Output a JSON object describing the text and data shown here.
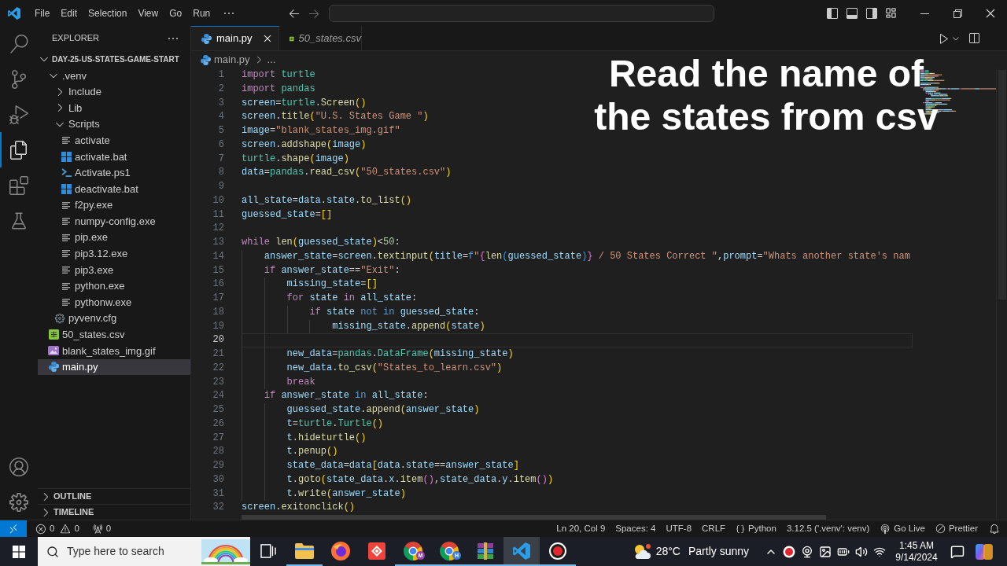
{
  "title_bar": {
    "menu": [
      "File",
      "Edit",
      "Selection",
      "View",
      "Go",
      "Run"
    ]
  },
  "activity_bar": {
    "items": [
      {
        "kind": "search",
        "selected": false
      },
      {
        "kind": "source_control",
        "selected": false
      },
      {
        "kind": "run_debug",
        "selected": false
      },
      {
        "kind": "explorer",
        "selected": true
      },
      {
        "kind": "extensions",
        "selected": false
      },
      {
        "kind": "testing",
        "selected": false
      }
    ]
  },
  "sidebar": {
    "title": "EXPLORER",
    "folder": {
      "name": "DAY-25-US-STATES-GAME-START",
      "expanded": true,
      "children": [
        {
          "name": ".venv",
          "kind": "folder",
          "expanded": true,
          "selected": false,
          "children": [
            {
              "name": "Include",
              "kind": "folder",
              "expanded": false,
              "selected": false
            },
            {
              "name": "Lib",
              "kind": "folder",
              "expanded": false,
              "selected": false
            },
            {
              "name": "Scripts",
              "kind": "folder",
              "expanded": true,
              "selected": false,
              "children": [
                {
                  "name": "activate",
                  "kind": "text",
                  "selected": false
                },
                {
                  "name": "activate.bat",
                  "kind": "batch",
                  "selected": false
                },
                {
                  "name": "Activate.ps1",
                  "kind": "powershell",
                  "selected": false
                },
                {
                  "name": "deactivate.bat",
                  "kind": "batch",
                  "selected": false
                },
                {
                  "name": "f2py.exe",
                  "kind": "text",
                  "selected": false
                },
                {
                  "name": "numpy-config.exe",
                  "kind": "text",
                  "selected": false
                },
                {
                  "name": "pip.exe",
                  "kind": "text",
                  "selected": false
                },
                {
                  "name": "pip3.12.exe",
                  "kind": "text",
                  "selected": false
                },
                {
                  "name": "pip3.exe",
                  "kind": "text",
                  "selected": false
                },
                {
                  "name": "python.exe",
                  "kind": "text",
                  "selected": false
                },
                {
                  "name": "pythonw.exe",
                  "kind": "text",
                  "selected": false
                }
              ]
            },
            {
              "name": "pyvenv.cfg",
              "kind": "config",
              "selected": false
            }
          ]
        },
        {
          "name": "50_states.csv",
          "kind": "csv",
          "selected": false
        },
        {
          "name": "blank_states_img.gif",
          "kind": "image",
          "selected": false
        },
        {
          "name": "main.py",
          "kind": "python",
          "selected": true
        }
      ]
    },
    "sections": [
      {
        "name": "OUTLINE",
        "expanded": false
      },
      {
        "name": "TIMELINE",
        "expanded": false
      }
    ]
  },
  "tabs": [
    {
      "label": "main.py",
      "kind": "python",
      "selected": true,
      "preview": false
    },
    {
      "label": "50_states.csv",
      "kind": "csv",
      "selected": false,
      "preview": true
    }
  ],
  "breadcrumb": {
    "file": "main.py",
    "kind": "python",
    "more": "..."
  },
  "editor": {
    "caption": [
      "Read the name of",
      "the states from csv"
    ],
    "lines": [
      {
        "number": "1",
        "current": false,
        "tokens": [
          {
            "kind": "keyword",
            "text": "import "
          },
          {
            "kind": "type",
            "text": "turtle"
          }
        ]
      },
      {
        "number": "2",
        "current": false,
        "tokens": [
          {
            "kind": "keyword",
            "text": "import "
          },
          {
            "kind": "type",
            "text": "pandas"
          }
        ]
      },
      {
        "number": "3",
        "current": false,
        "tokens": [
          {
            "kind": "variable",
            "text": "screen"
          },
          {
            "kind": "plain",
            "text": "="
          },
          {
            "kind": "type",
            "text": "turtle"
          },
          {
            "kind": "plain",
            "text": "."
          },
          {
            "kind": "function",
            "text": "Screen"
          },
          {
            "kind": "bracket",
            "text": "()"
          }
        ]
      },
      {
        "number": "4",
        "current": false,
        "tokens": [
          {
            "kind": "variable",
            "text": "screen"
          },
          {
            "kind": "plain",
            "text": "."
          },
          {
            "kind": "function",
            "text": "title"
          },
          {
            "kind": "bracket",
            "text": "("
          },
          {
            "kind": "string",
            "text": "\"U.S. States Game \""
          },
          {
            "kind": "bracket",
            "text": ")"
          }
        ]
      },
      {
        "number": "5",
        "current": false,
        "tokens": [
          {
            "kind": "variable",
            "text": "image"
          },
          {
            "kind": "plain",
            "text": "="
          },
          {
            "kind": "string",
            "text": "\"blank_states_img.gif\""
          }
        ]
      },
      {
        "number": "6",
        "current": false,
        "tokens": [
          {
            "kind": "variable",
            "text": "screen"
          },
          {
            "kind": "plain",
            "text": "."
          },
          {
            "kind": "function",
            "text": "addshape"
          },
          {
            "kind": "bracket",
            "text": "("
          },
          {
            "kind": "variable",
            "text": "image"
          },
          {
            "kind": "bracket",
            "text": ")"
          }
        ]
      },
      {
        "number": "7",
        "current": false,
        "tokens": [
          {
            "kind": "type",
            "text": "turtle"
          },
          {
            "kind": "plain",
            "text": "."
          },
          {
            "kind": "function",
            "text": "shape"
          },
          {
            "kind": "bracket",
            "text": "("
          },
          {
            "kind": "variable",
            "text": "image"
          },
          {
            "kind": "bracket",
            "text": ")"
          }
        ]
      },
      {
        "number": "8",
        "current": false,
        "tokens": [
          {
            "kind": "variable",
            "text": "data"
          },
          {
            "kind": "plain",
            "text": "="
          },
          {
            "kind": "type",
            "text": "pandas"
          },
          {
            "kind": "plain",
            "text": "."
          },
          {
            "kind": "function",
            "text": "read_csv"
          },
          {
            "kind": "bracket",
            "text": "("
          },
          {
            "kind": "string",
            "text": "\"50_states.csv\""
          },
          {
            "kind": "bracket",
            "text": ")"
          }
        ]
      },
      {
        "number": "9",
        "current": false
      },
      {
        "number": "10",
        "current": false,
        "tokens": [
          {
            "kind": "variable",
            "text": "all_state"
          },
          {
            "kind": "plain",
            "text": "="
          },
          {
            "kind": "variable",
            "text": "data"
          },
          {
            "kind": "plain",
            "text": "."
          },
          {
            "kind": "variable",
            "text": "state"
          },
          {
            "kind": "plain",
            "text": "."
          },
          {
            "kind": "function",
            "text": "to_list"
          },
          {
            "kind": "bracket",
            "text": "()"
          }
        ]
      },
      {
        "number": "11",
        "current": false,
        "tokens": [
          {
            "kind": "variable",
            "text": "guessed_state"
          },
          {
            "kind": "plain",
            "text": "="
          },
          {
            "kind": "bracket",
            "text": "[]"
          }
        ]
      },
      {
        "number": "12",
        "current": false
      },
      {
        "number": "13",
        "current": false,
        "tokens": [
          {
            "kind": "keyword",
            "text": "while "
          },
          {
            "kind": "function",
            "text": "len"
          },
          {
            "kind": "bracket",
            "text": "("
          },
          {
            "kind": "variable",
            "text": "guessed_state"
          },
          {
            "kind": "bracket",
            "text": ")"
          },
          {
            "kind": "plain",
            "text": "<"
          },
          {
            "kind": "number",
            "text": "50"
          },
          {
            "kind": "plain",
            "text": ":"
          }
        ]
      },
      {
        "number": "14",
        "current": false,
        "tokens": [
          {
            "kind": "variable",
            "text": "    answer_state"
          },
          {
            "kind": "plain",
            "text": "="
          },
          {
            "kind": "variable",
            "text": "screen"
          },
          {
            "kind": "plain",
            "text": "."
          },
          {
            "kind": "function",
            "text": "textinput"
          },
          {
            "kind": "bracket",
            "text": "("
          },
          {
            "kind": "variable",
            "text": "title"
          },
          {
            "kind": "plain",
            "text": "="
          },
          {
            "kind": "operator",
            "text": "f"
          },
          {
            "kind": "string",
            "text": "\""
          },
          {
            "kind": "bracket2",
            "text": "{"
          },
          {
            "kind": "function",
            "text": "len"
          },
          {
            "kind": "bracket3",
            "text": "("
          },
          {
            "kind": "variable",
            "text": "guessed_state"
          },
          {
            "kind": "bracket3",
            "text": ")"
          },
          {
            "kind": "bracket2",
            "text": "}"
          },
          {
            "kind": "string",
            "text": " / 50 States Correct \""
          },
          {
            "kind": "plain",
            "text": ","
          },
          {
            "kind": "variable",
            "text": "prompt"
          },
          {
            "kind": "plain",
            "text": "="
          },
          {
            "kind": "string",
            "text": "\"Whats another state's nam"
          }
        ]
      },
      {
        "number": "15",
        "current": false,
        "tokens": [
          {
            "kind": "keyword",
            "text": "    if "
          },
          {
            "kind": "variable",
            "text": "answer_state"
          },
          {
            "kind": "plain",
            "text": "=="
          },
          {
            "kind": "string",
            "text": "\"Exit\""
          },
          {
            "kind": "plain",
            "text": ":"
          }
        ]
      },
      {
        "number": "16",
        "current": false,
        "tokens": [
          {
            "kind": "variable",
            "text": "        missing_state"
          },
          {
            "kind": "plain",
            "text": "="
          },
          {
            "kind": "bracket",
            "text": "[]"
          }
        ]
      },
      {
        "number": "17",
        "current": false,
        "tokens": [
          {
            "kind": "keyword",
            "text": "        for "
          },
          {
            "kind": "variable",
            "text": "state "
          },
          {
            "kind": "keyword",
            "text": "in "
          },
          {
            "kind": "variable",
            "text": "all_state"
          },
          {
            "kind": "plain",
            "text": ":"
          }
        ]
      },
      {
        "number": "18",
        "current": false,
        "tokens": [
          {
            "kind": "keyword",
            "text": "            if "
          },
          {
            "kind": "variable",
            "text": "state "
          },
          {
            "kind": "operator",
            "text": "not in "
          },
          {
            "kind": "variable",
            "text": "guessed_state"
          },
          {
            "kind": "plain",
            "text": ":"
          }
        ]
      },
      {
        "number": "19",
        "current": false,
        "tokens": [
          {
            "kind": "variable",
            "text": "                missing_state"
          },
          {
            "kind": "plain",
            "text": "."
          },
          {
            "kind": "function",
            "text": "append"
          },
          {
            "kind": "bracket",
            "text": "("
          },
          {
            "kind": "variable",
            "text": "state"
          },
          {
            "kind": "bracket",
            "text": ")"
          }
        ]
      },
      {
        "number": "20",
        "current": true
      },
      {
        "number": "21",
        "current": false,
        "tokens": [
          {
            "kind": "variable",
            "text": "        new_data"
          },
          {
            "kind": "plain",
            "text": "="
          },
          {
            "kind": "type",
            "text": "pandas"
          },
          {
            "kind": "plain",
            "text": "."
          },
          {
            "kind": "type",
            "text": "DataFrame"
          },
          {
            "kind": "bracket",
            "text": "("
          },
          {
            "kind": "variable",
            "text": "missing_state"
          },
          {
            "kind": "bracket",
            "text": ")"
          }
        ]
      },
      {
        "number": "22",
        "current": false,
        "tokens": [
          {
            "kind": "variable",
            "text": "        new_data"
          },
          {
            "kind": "plain",
            "text": "."
          },
          {
            "kind": "function",
            "text": "to_csv"
          },
          {
            "kind": "bracket",
            "text": "("
          },
          {
            "kind": "string",
            "text": "\"States_to_learn.csv\""
          },
          {
            "kind": "bracket",
            "text": ")"
          }
        ]
      },
      {
        "number": "23",
        "current": false,
        "tokens": [
          {
            "kind": "keyword",
            "text": "        break"
          }
        ]
      },
      {
        "number": "24",
        "current": false,
        "tokens": [
          {
            "kind": "keyword",
            "text": "    if "
          },
          {
            "kind": "variable",
            "text": "answer_state "
          },
          {
            "kind": "operator",
            "text": "in "
          },
          {
            "kind": "variable",
            "text": "all_state"
          },
          {
            "kind": "plain",
            "text": ":"
          }
        ]
      },
      {
        "number": "25",
        "current": false,
        "tokens": [
          {
            "kind": "variable",
            "text": "        guessed_state"
          },
          {
            "kind": "plain",
            "text": "."
          },
          {
            "kind": "function",
            "text": "append"
          },
          {
            "kind": "bracket",
            "text": "("
          },
          {
            "kind": "variable",
            "text": "answer_state"
          },
          {
            "kind": "bracket",
            "text": ")"
          }
        ]
      },
      {
        "number": "26",
        "current": false,
        "tokens": [
          {
            "kind": "variable",
            "text": "        t"
          },
          {
            "kind": "plain",
            "text": "="
          },
          {
            "kind": "type",
            "text": "turtle"
          },
          {
            "kind": "plain",
            "text": "."
          },
          {
            "kind": "type",
            "text": "Turtle"
          },
          {
            "kind": "bracket",
            "text": "()"
          }
        ]
      },
      {
        "number": "27",
        "current": false,
        "tokens": [
          {
            "kind": "variable",
            "text": "        t"
          },
          {
            "kind": "plain",
            "text": "."
          },
          {
            "kind": "function",
            "text": "hideturtle"
          },
          {
            "kind": "bracket",
            "text": "()"
          }
        ]
      },
      {
        "number": "28",
        "current": false,
        "tokens": [
          {
            "kind": "variable",
            "text": "        t"
          },
          {
            "kind": "plain",
            "text": "."
          },
          {
            "kind": "function",
            "text": "penup"
          },
          {
            "kind": "bracket",
            "text": "()"
          }
        ]
      },
      {
        "number": "29",
        "current": false,
        "tokens": [
          {
            "kind": "variable",
            "text": "        state_data"
          },
          {
            "kind": "plain",
            "text": "="
          },
          {
            "kind": "variable",
            "text": "data"
          },
          {
            "kind": "bracket",
            "text": "["
          },
          {
            "kind": "variable",
            "text": "data"
          },
          {
            "kind": "plain",
            "text": "."
          },
          {
            "kind": "variable",
            "text": "state"
          },
          {
            "kind": "plain",
            "text": "=="
          },
          {
            "kind": "variable",
            "text": "answer_state"
          },
          {
            "kind": "bracket",
            "text": "]"
          }
        ]
      },
      {
        "number": "30",
        "current": false,
        "tokens": [
          {
            "kind": "variable",
            "text": "        t"
          },
          {
            "kind": "plain",
            "text": "."
          },
          {
            "kind": "function",
            "text": "goto"
          },
          {
            "kind": "bracket",
            "text": "("
          },
          {
            "kind": "variable",
            "text": "state_data"
          },
          {
            "kind": "plain",
            "text": "."
          },
          {
            "kind": "variable",
            "text": "x"
          },
          {
            "kind": "plain",
            "text": "."
          },
          {
            "kind": "function",
            "text": "item"
          },
          {
            "kind": "bracket2",
            "text": "()"
          },
          {
            "kind": "plain",
            "text": ","
          },
          {
            "kind": "variable",
            "text": "state_data"
          },
          {
            "kind": "plain",
            "text": "."
          },
          {
            "kind": "variable",
            "text": "y"
          },
          {
            "kind": "plain",
            "text": "."
          },
          {
            "kind": "function",
            "text": "item"
          },
          {
            "kind": "bracket2",
            "text": "()"
          },
          {
            "kind": "bracket",
            "text": ")"
          }
        ]
      },
      {
        "number": "31",
        "current": false,
        "tokens": [
          {
            "kind": "variable",
            "text": "        t"
          },
          {
            "kind": "plain",
            "text": "."
          },
          {
            "kind": "function",
            "text": "write"
          },
          {
            "kind": "bracket",
            "text": "("
          },
          {
            "kind": "variable",
            "text": "answer_state"
          },
          {
            "kind": "bracket",
            "text": ")"
          }
        ]
      },
      {
        "number": "32",
        "current": false,
        "tokens": [
          {
            "kind": "variable",
            "text": "screen"
          },
          {
            "kind": "plain",
            "text": "."
          },
          {
            "kind": "function",
            "text": "exitonclick"
          },
          {
            "kind": "bracket",
            "text": "()"
          }
        ]
      }
    ]
  },
  "status_bar": {
    "errors": "0",
    "warnings": "0",
    "ports": "0",
    "cursor": "Ln 20, Col 9",
    "indentation": "Spaces: 4",
    "encoding": "UTF-8",
    "line_ending": "CRLF",
    "language": "Python",
    "interpreter": "3.12.5 ('.venv': venv)",
    "go_live": "Go Live",
    "formatter": "Prettier"
  },
  "taskbar": {
    "search": {
      "placeholder": "Type here to search"
    },
    "apps": [
      {
        "kind": "task_view",
        "selected": false,
        "running": false
      },
      {
        "kind": "folder",
        "selected": false,
        "running": true
      },
      {
        "kind": "browser",
        "selected": false,
        "running": false
      },
      {
        "kind": "remote",
        "selected": false,
        "running": false
      },
      {
        "kind": "chrome",
        "selected": false,
        "running": true,
        "badge": "M",
        "color": "#9b3fb5"
      },
      {
        "kind": "chrome",
        "selected": false,
        "running": true,
        "badge": "H",
        "color": "#3d7fd6"
      },
      {
        "kind": "archive",
        "selected": false,
        "running": true
      },
      {
        "kind": "code",
        "selected": true,
        "running": true
      },
      {
        "kind": "recorder",
        "selected": false,
        "running": true
      }
    ],
    "weather": {
      "temperature": "28°C",
      "condition": "Partly sunny"
    },
    "clock": {
      "time": "1:45 AM",
      "date": "9/14/2024"
    }
  }
}
